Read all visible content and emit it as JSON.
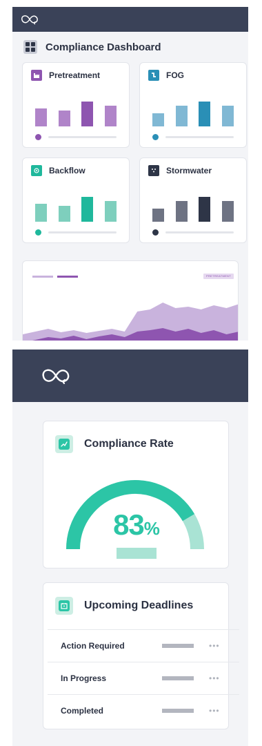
{
  "colors": {
    "navy": "#3a4258",
    "pretreatment": "#8e55b0",
    "fog": "#2a8fb6",
    "backflow": "#1fb89c",
    "stormwater": "#2e3547",
    "teal": "#2cc5a6"
  },
  "panel1": {
    "logo_icon": "infinity-loop-icon",
    "dashboard": {
      "icon": "grid-dashboard-icon",
      "title": "Compliance Dashboard"
    },
    "cards": [
      {
        "title": "Pretreatment",
        "icon": "factory-icon",
        "color": "#8e55b0",
        "light": "#b084c9",
        "bars": [
          0.62,
          0.55,
          0.85,
          0.72
        ],
        "highlight": 2
      },
      {
        "title": "FOG",
        "icon": "pipe-icon",
        "color": "#2a8fb6",
        "light": "#80b8d4",
        "bars": [
          0.45,
          0.72,
          0.85,
          0.7
        ],
        "highlight": 2
      },
      {
        "title": "Backflow",
        "icon": "valve-icon",
        "color": "#1fb89c",
        "light": "#7ecfbd",
        "bars": [
          0.62,
          0.55,
          0.85,
          0.72
        ],
        "highlight": 2
      },
      {
        "title": "Stormwater",
        "icon": "rain-cloud-icon",
        "color": "#2e3547",
        "light": "#6e7383",
        "bars": [
          0.45,
          0.72,
          0.85,
          0.7
        ],
        "highlight": 2
      }
    ],
    "area_chart": {
      "tag": "PRETREATMENT",
      "series_back": [
        0.22,
        0.26,
        0.3,
        0.25,
        0.28,
        0.24,
        0.27,
        0.3,
        0.26,
        0.55,
        0.58,
        0.68,
        0.6,
        0.62,
        0.58,
        0.64,
        0.6,
        0.66
      ],
      "series_front": [
        0.1,
        0.14,
        0.18,
        0.16,
        0.2,
        0.15,
        0.19,
        0.22,
        0.18,
        0.26,
        0.28,
        0.31,
        0.26,
        0.3,
        0.24,
        0.28,
        0.22,
        0.26
      ]
    }
  },
  "panel2": {
    "logo_icon": "infinity-loop-icon",
    "compliance_rate": {
      "icon": "trend-chart-icon",
      "title": "Compliance Rate",
      "value": "83",
      "unit": "%",
      "fraction": 0.83
    },
    "deadlines": {
      "icon": "calendar-icon",
      "title": "Upcoming Deadlines",
      "rows": [
        {
          "label": "Action Required",
          "more": "•••"
        },
        {
          "label": "In Progress",
          "more": "•••"
        },
        {
          "label": "Completed",
          "more": "•••"
        }
      ]
    }
  }
}
